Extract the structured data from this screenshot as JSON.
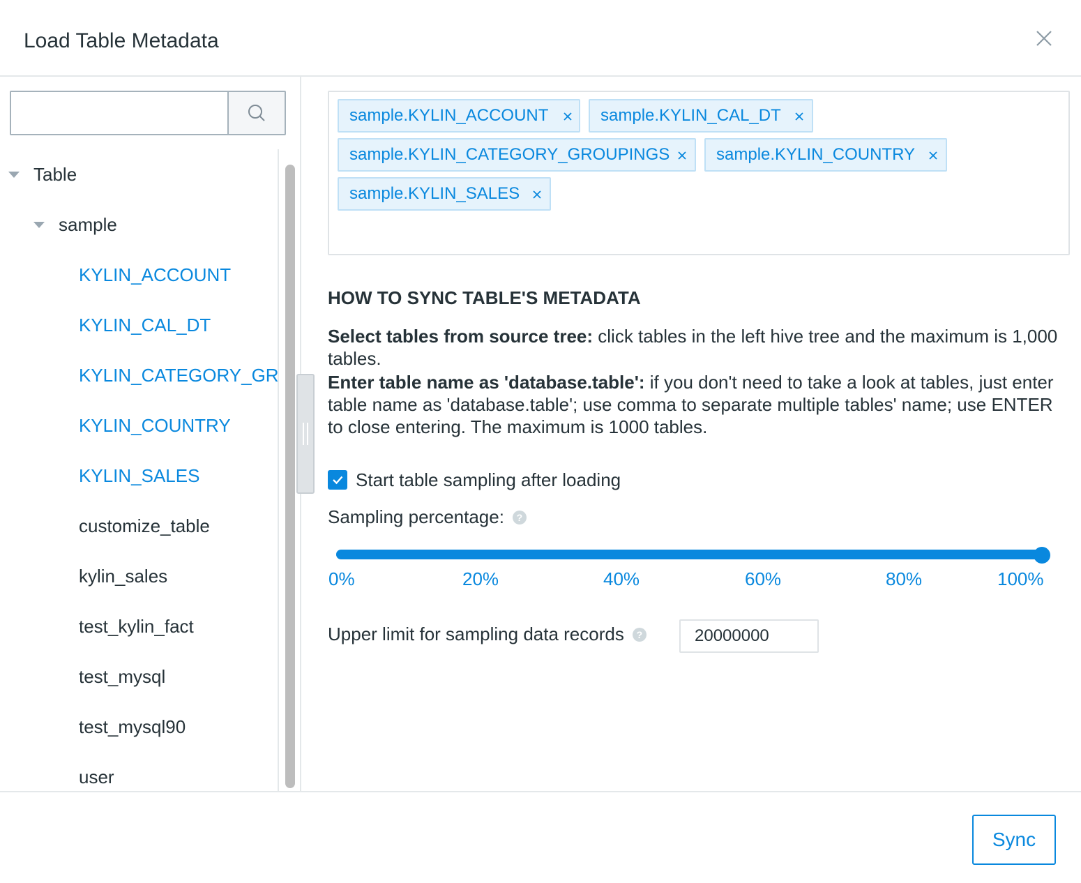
{
  "dialog": {
    "title": "Load Table Metadata",
    "close_icon": "close-icon"
  },
  "search": {
    "value": "",
    "placeholder": "",
    "icon": "search-icon"
  },
  "tree": {
    "root_label": "Table",
    "database_label": "sample",
    "tables": [
      {
        "label": "KYLIN_ACCOUNT",
        "selected": true
      },
      {
        "label": "KYLIN_CAL_DT",
        "selected": true
      },
      {
        "label": "KYLIN_CATEGORY_GROUPINGS",
        "selected": true
      },
      {
        "label": "KYLIN_COUNTRY",
        "selected": true
      },
      {
        "label": "KYLIN_SALES",
        "selected": true
      },
      {
        "label": "customize_table",
        "selected": false
      },
      {
        "label": "kylin_sales",
        "selected": false
      },
      {
        "label": "test_kylin_fact",
        "selected": false
      },
      {
        "label": "test_mysql",
        "selected": false
      },
      {
        "label": "test_mysql90",
        "selected": false
      },
      {
        "label": "user",
        "selected": false
      }
    ]
  },
  "selected_tags": [
    "sample.KYLIN_ACCOUNT",
    "sample.KYLIN_CAL_DT",
    "sample.KYLIN_CATEGORY_GROUPINGS",
    "sample.KYLIN_COUNTRY",
    "sample.KYLIN_SALES"
  ],
  "howto": {
    "title": "HOW TO SYNC TABLE'S METADATA",
    "p1_bold": "Select tables from source tree:",
    "p1_text": " click tables in the left hive tree and the maximum is 1,000 tables.",
    "p2_bold": "Enter table name as 'database.table':",
    "p2_text": " if you don't need to take a look at tables, just enter table name as 'database.table'; use comma to separate multiple tables' name; use ENTER to close entering. The maximum is 1000 tables."
  },
  "sampling": {
    "checkbox_label": "Start table sampling after loading",
    "checked": true,
    "percentage_label": "Sampling percentage:",
    "slider_value_percent": 100,
    "slider_marks": [
      "0%",
      "20%",
      "40%",
      "60%",
      "80%",
      "100%"
    ],
    "limit_label": "Upper limit for sampling data records",
    "limit_value": "20000000",
    "help_icon": "question-circle-icon"
  },
  "footer": {
    "sync_label": "Sync"
  },
  "colors": {
    "accent": "#0988de",
    "tag_bg": "#e6f3fc",
    "text": "#263238",
    "border": "#dfe3e6"
  }
}
